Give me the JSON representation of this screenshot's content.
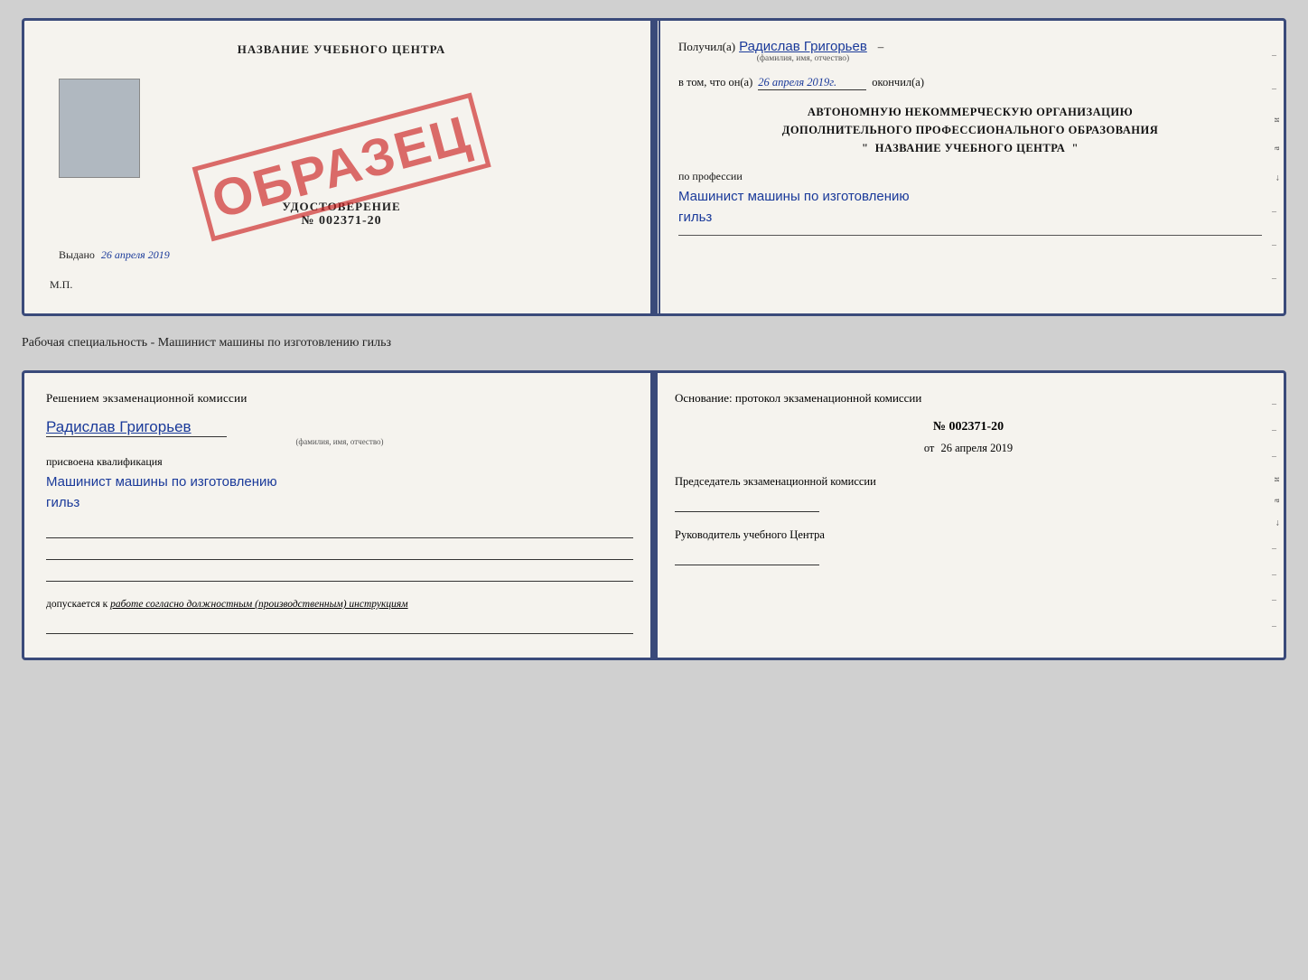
{
  "doc1": {
    "left": {
      "center_title": "НАЗВАНИЕ УЧЕБНОГО ЦЕНТРА",
      "stamp_text": "ОБРАЗЕЦ",
      "udostoverenie_title": "УДОСТОВЕРЕНИЕ",
      "udostoverenie_num": "№ 002371-20",
      "vydano_label": "Выдано",
      "vydano_date": "26 апреля 2019",
      "mp_label": "М.П."
    },
    "right": {
      "poluchil_prefix": "Получил(а)",
      "name_handwritten": "Радислав Григорьев",
      "name_sublabel": "(фамилия, имя, отчество)",
      "v_tom_prefix": "в том, что он(а)",
      "date_value": "26 апреля 2019г.",
      "okonchil_suffix": "окончил(а)",
      "org_line1": "АВТОНОМНУЮ НЕКОММЕРЧЕСКУЮ ОРГАНИЗАЦИЮ",
      "org_line2": "ДОПОЛНИТЕЛЬНОГО ПРОФЕССИОНАЛЬНОГО ОБРАЗОВАНИЯ",
      "org_quote1": "\"",
      "org_name": "НАЗВАНИЕ УЧЕБНОГО ЦЕНТРА",
      "org_quote2": "\"",
      "po_professii_label": "по профессии",
      "profession_line1": "Машинист машины по изготовлению",
      "profession_line2": "гильз"
    }
  },
  "between_label": "Рабочая специальность - Машинист машины по изготовлению гильз",
  "doc2": {
    "left": {
      "section_title": "Решением  экзаменационной  комиссии",
      "name_handwritten": "Радислав Григорьев",
      "name_sublabel": "(фамилия, имя, отчество)",
      "prisvoena_label": "присвоена квалификация",
      "qualification_line1": "Машинист  машины  по изготовлению",
      "qualification_line2": "гильз",
      "dopuskaetsya_prefix": "допускается к",
      "dopuskaetsya_value": "работе согласно должностным (производственным) инструкциям"
    },
    "right": {
      "osnov_title": "Основание: протокол экзаменационной  комиссии",
      "protocol_num": "№  002371-20",
      "protocol_date_prefix": "от",
      "protocol_date": "26 апреля 2019",
      "predsedatel_title": "Председатель экзаменационной комиссии",
      "rukovoditel_title": "Руководитель учебного Центра"
    }
  }
}
